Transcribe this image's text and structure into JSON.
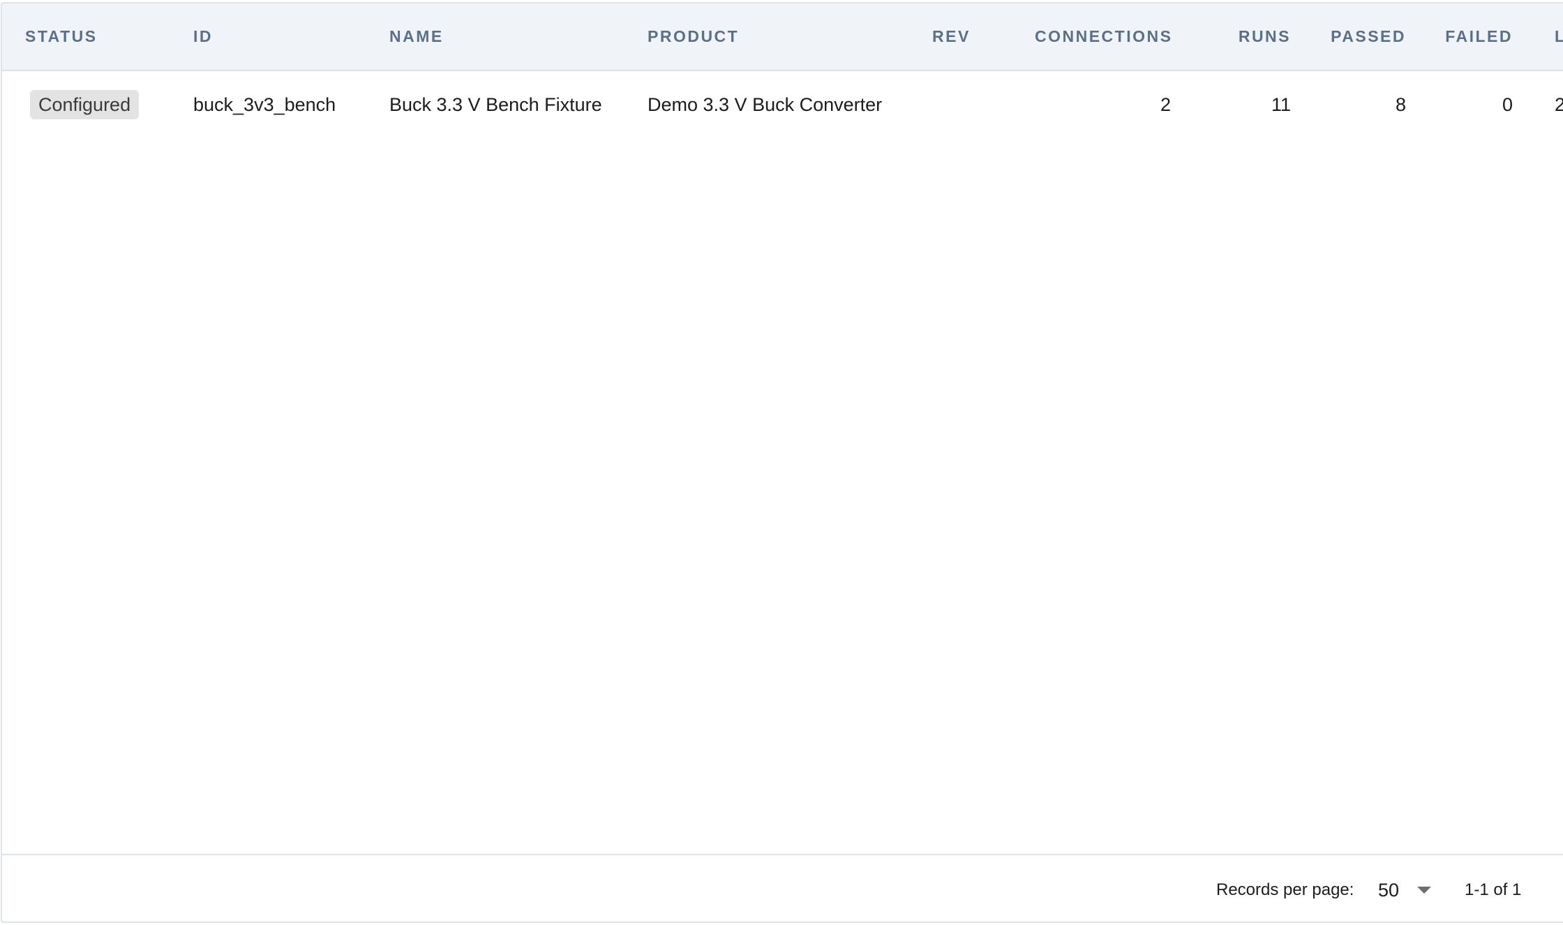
{
  "table": {
    "columns": [
      {
        "key": "status",
        "label": "STATUS"
      },
      {
        "key": "id",
        "label": "ID"
      },
      {
        "key": "name",
        "label": "NAME"
      },
      {
        "key": "product",
        "label": "PRODUCT"
      },
      {
        "key": "rev",
        "label": "REV"
      },
      {
        "key": "connections",
        "label": "CONNECTIONS"
      },
      {
        "key": "runs",
        "label": "RUNS"
      },
      {
        "key": "passed",
        "label": "PASSED"
      },
      {
        "key": "failed",
        "label": "FAILED"
      },
      {
        "key": "last",
        "label": "L"
      }
    ],
    "rows": [
      {
        "status": "Configured",
        "id": "buck_3v3_bench",
        "name": "Buck 3.3 V Bench Fixture",
        "product": "Demo 3.3 V Buck Converter",
        "rev": "",
        "connections": "2",
        "runs": "11",
        "passed": "8",
        "failed": "0",
        "last": "2"
      }
    ]
  },
  "footer": {
    "records_per_page_label": "Records per page:",
    "records_per_page_value": "50",
    "page_info": "1-1 of 1"
  },
  "colors": {
    "header_background": "#f0f4f9",
    "header_text": "#5d6f87",
    "badge_background": "#e3e3e3",
    "border": "#dfe3e8"
  }
}
